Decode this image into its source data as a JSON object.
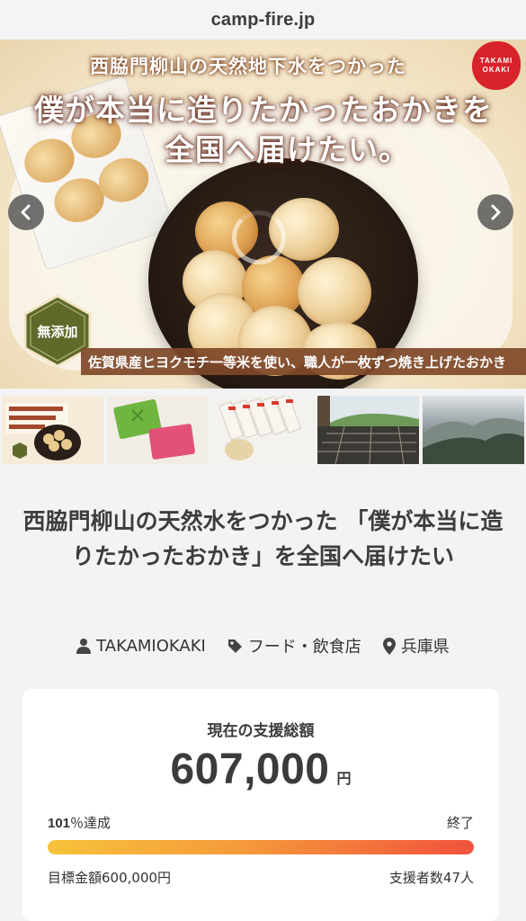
{
  "browser": {
    "url": "camp-fire.jp"
  },
  "hero": {
    "headline_line1": "西脇門柳山の天然地下水をつかった",
    "headline_line2": "僕が本当に造りたかったおかきを",
    "headline_line3": "全国へ届けたい。",
    "logo_line1": "TAKAMI",
    "logo_line2": "OKAKI",
    "badge": "無添加",
    "caption": "佐賀県産ヒヨクモチ一等米を使い、職人が一枚ずつ焼き上げたおかき",
    "prev_icon": "chevron-left-icon",
    "next_icon": "chevron-right-icon"
  },
  "thumbnails": [
    {
      "name": "thumb-okaki-plate"
    },
    {
      "name": "thumb-wrapped-gifts"
    },
    {
      "name": "thumb-packages"
    },
    {
      "name": "thumb-factory"
    },
    {
      "name": "thumb-mountains"
    }
  ],
  "project": {
    "title": "西脇門柳山の天然水をつかった 「僕が本当に造りたかったおかき」を全国へ届けたい",
    "owner": "TAKAMIOKAKI",
    "category": "フード・飲食店",
    "location": "兵庫県"
  },
  "funding": {
    "label": "現在の支援総額",
    "amount": "607,000",
    "unit": "円",
    "percent": "101",
    "percent_suffix": "％達成",
    "status": "終了",
    "progress_fraction": 1.0,
    "goal": "目標金額600,000円",
    "backers": "支援者数47人"
  },
  "colors": {
    "progress_start": "#f7c23a",
    "progress_end": "#f1523c",
    "caption_bg": "#7e4828",
    "badge": "#5e6a2a"
  }
}
